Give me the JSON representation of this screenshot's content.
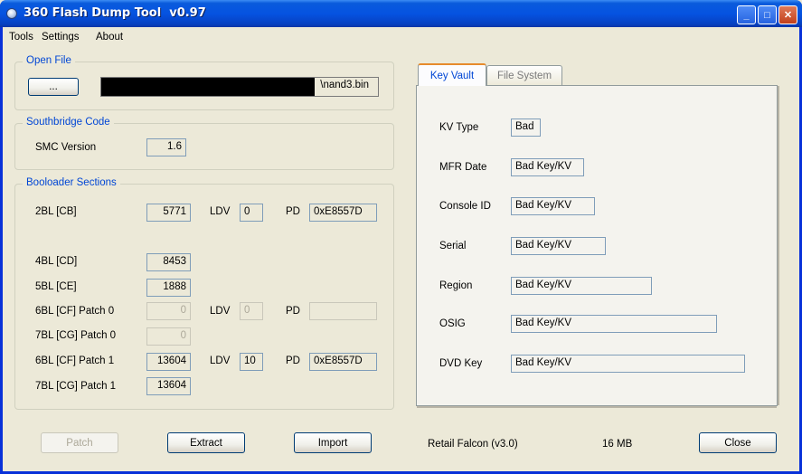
{
  "window": {
    "title": "360 Flash Dump Tool  v0.97"
  },
  "menu": [
    "Tools",
    "Settings",
    "About"
  ],
  "open_file": {
    "legend": "Open File",
    "browse_label": "...",
    "path_suffix": "\\nand3.bin"
  },
  "southbridge": {
    "legend": "Southbridge Code",
    "smc_label": "SMC Version",
    "smc_value": "1.6"
  },
  "bootloader": {
    "legend": "Booloader Sections",
    "rows": [
      {
        "label": "2BL [CB]",
        "value": "5771",
        "ldv_label": "LDV",
        "ldv": "0",
        "pd_label": "PD",
        "pd": "0xE8557D"
      },
      {
        "label": "4BL [CD]",
        "value": "8453"
      },
      {
        "label": "5BL [CE]",
        "value": "1888"
      },
      {
        "label": "6BL [CF] Patch 0",
        "value": "0",
        "ldv_label": "LDV",
        "ldv": "0",
        "pd_label": "PD",
        "pd": ""
      },
      {
        "label": "7BL [CG] Patch 0",
        "value": "0"
      },
      {
        "label": "6BL [CF] Patch 1",
        "value": "13604",
        "ldv_label": "LDV",
        "ldv": "10",
        "pd_label": "PD",
        "pd": "0xE8557D"
      },
      {
        "label": "7BL [CG] Patch 1",
        "value": "13604"
      }
    ]
  },
  "tabs": [
    "Key Vault",
    "File System"
  ],
  "keyvault": [
    {
      "label": "KV Type",
      "value": "Bad"
    },
    {
      "label": "MFR Date",
      "value": "Bad Key/KV"
    },
    {
      "label": "Console ID",
      "value": "Bad Key/KV"
    },
    {
      "label": "Serial",
      "value": "Bad Key/KV"
    },
    {
      "label": "Region",
      "value": "Bad Key/KV"
    },
    {
      "label": "OSIG",
      "value": "Bad Key/KV"
    },
    {
      "label": "DVD Key",
      "value": "Bad Key/KV"
    }
  ],
  "footer": {
    "patch": "Patch",
    "extract": "Extract",
    "import": "Import",
    "console_type": "Retail Falcon (v3.0)",
    "size": "16 MB",
    "close": "Close"
  }
}
